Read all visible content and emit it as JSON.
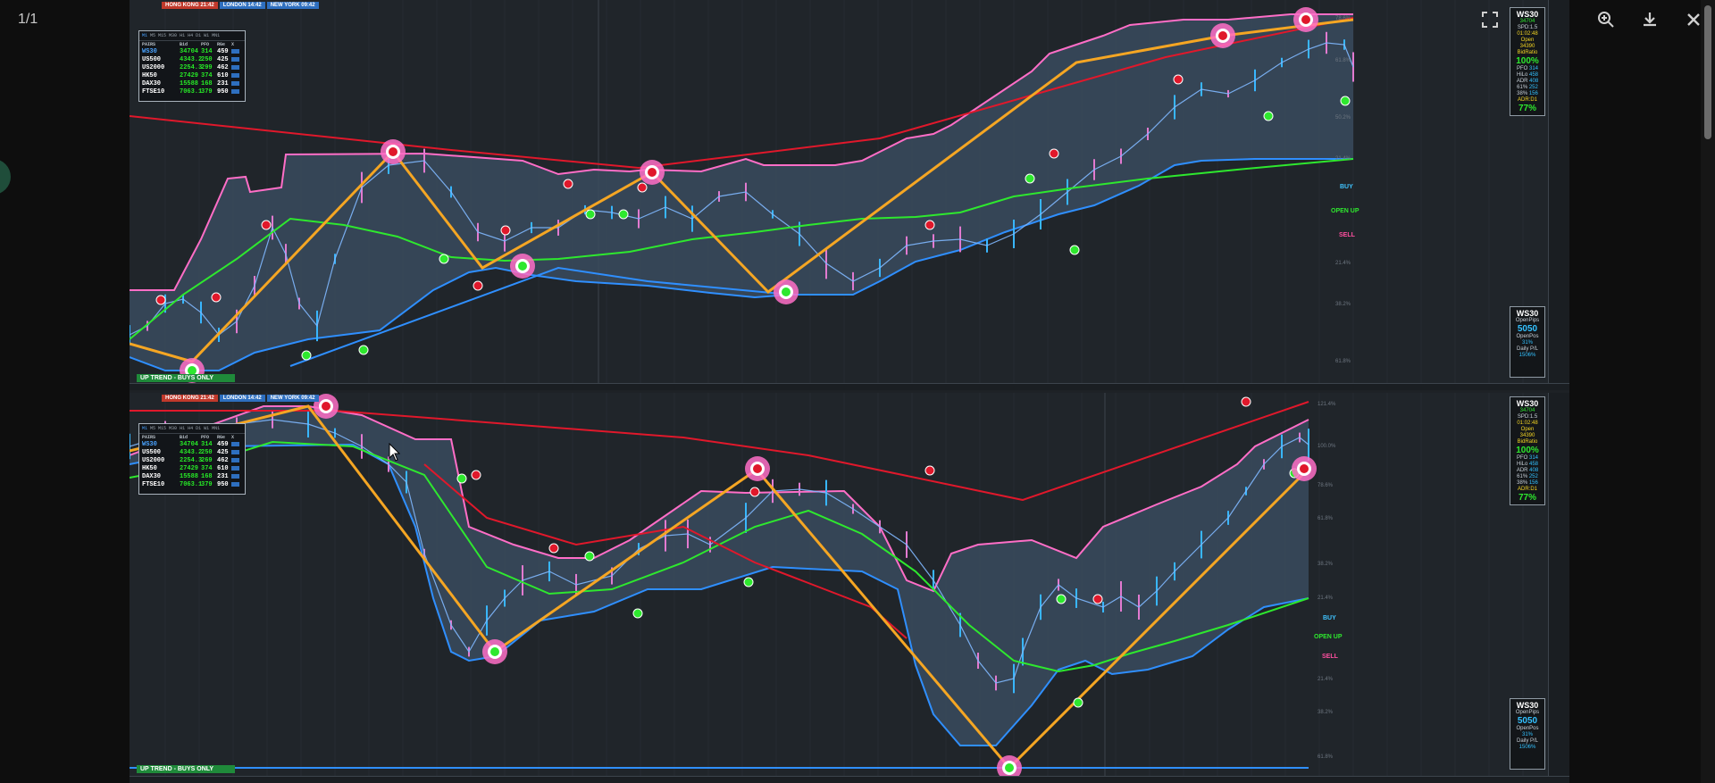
{
  "viewer": {
    "counter": "1/1",
    "toolbar": [
      {
        "name": "fullscreen-icon"
      },
      {
        "name": "zoom-in-icon"
      },
      {
        "name": "download-icon"
      },
      {
        "name": "close-icon"
      }
    ]
  },
  "colors": {
    "background": "#20252a",
    "cloud_fill": "#3a4b5e",
    "upper_band": "#ff6ec7",
    "lower_band": "#2f8fff",
    "zigzag": "#f5a623",
    "long_ma": "#2ee82e",
    "trendline": "#e0182b"
  },
  "top_chart": {
    "timezones": {
      "hk": "HONG KONG 21:42",
      "ld": "LONDON 14:42",
      "ny": "NEW YORK 09:42"
    },
    "pairs_tabs": [
      "M1",
      "M5",
      "M15",
      "M30",
      "H1",
      "H4",
      "D1",
      "W1",
      "MN1"
    ],
    "pairs_head": [
      "PAIRS",
      "Bid",
      "PFO",
      "RGe",
      "X"
    ],
    "pairs": [
      {
        "sym": "WS30",
        "bid": "34704",
        "pfo": "314",
        "rng": "459"
      },
      {
        "sym": "US500",
        "bid": "4343.2",
        "pfo": "250",
        "rng": "425"
      },
      {
        "sym": "US2000",
        "bid": "2254.3",
        "pfo": "299",
        "rng": "462"
      },
      {
        "sym": "HK50",
        "bid": "27429",
        "pfo": "374",
        "rng": "610"
      },
      {
        "sym": "DAX30",
        "bid": "15588",
        "pfo": "168",
        "rng": "231"
      },
      {
        "sym": "FTSE10",
        "bid": "7063.1",
        "pfo": "379",
        "rng": "950"
      }
    ],
    "trend": "UP TREND - BUYS ONLY",
    "signals": {
      "buy": "BUY",
      "open": "OPEN UP",
      "sell": "SELL"
    },
    "fibs": [
      "78.6%",
      "61.8%",
      "50.2%",
      "21.4%",
      "21.4%",
      "38.2%",
      "61.8%"
    ],
    "info_top": {
      "title": "WS30",
      "price": "34704",
      "spd": "SPD:1.5",
      "time": "01:02:48",
      "open_label": "Open",
      "open": "34390",
      "bid_label": "BidRatio",
      "bid": "100%",
      "pfo": "PFO",
      "hilo": "HiLo",
      "adr": "ADR",
      "p1": "61%",
      "p2": "38%",
      "adr_d": "ADR:D1",
      "adr_pct": "77%",
      "pfo_v": "314",
      "hilo_v": "458",
      "adr_v": "408",
      "p1_v": "252",
      "p2_v": "156"
    },
    "info_bottom": {
      "title": "WS30",
      "label1": "OpenPips",
      "val1": "5050",
      "label2": "OpenPos",
      "val2": "31%",
      "label3": "Daily P/L",
      "val3": "1506%"
    }
  },
  "bottom_chart": {
    "timezones": {
      "hk": "HONG KONG 21:42",
      "ld": "LONDON 14:42",
      "ny": "NEW YORK 09:42"
    },
    "pairs_tabs": [
      "M1",
      "M5",
      "M15",
      "M30",
      "H1",
      "H4",
      "D1",
      "W1",
      "MN1"
    ],
    "pairs_head": [
      "PAIRS",
      "Bid",
      "PFO",
      "RGe",
      "X"
    ],
    "pairs": [
      {
        "sym": "WS30",
        "bid": "34704",
        "pfo": "314",
        "rng": "459"
      },
      {
        "sym": "US500",
        "bid": "4343.2",
        "pfo": "250",
        "rng": "425"
      },
      {
        "sym": "US2000",
        "bid": "2254.3",
        "pfo": "269",
        "rng": "462"
      },
      {
        "sym": "HK50",
        "bid": "27429",
        "pfo": "374",
        "rng": "610"
      },
      {
        "sym": "DAX30",
        "bid": "15588",
        "pfo": "168",
        "rng": "231"
      },
      {
        "sym": "FTSE10",
        "bid": "7063.1",
        "pfo": "379",
        "rng": "950"
      }
    ],
    "trend": "UP TREND - BUYS ONLY",
    "signals": {
      "buy": "BUY",
      "open": "OPEN UP",
      "sell": "SELL"
    },
    "fibs": [
      "121.4%",
      "100.0%",
      "78.6%",
      "61.8%",
      "38.2%",
      "21.4%",
      "21.4%",
      "38.2%",
      "61.8%"
    ],
    "info_top": {
      "title": "WS30",
      "price": "34704",
      "spd": "SPD:1.5",
      "time": "01:02:48",
      "open_label": "Open",
      "open": "34390",
      "bid_label": "BidRatio",
      "bid": "100%",
      "pfo": "PFO",
      "hilo": "HiLo",
      "adr": "ADR",
      "p1": "61%",
      "p2": "38%",
      "adr_d": "ADR:D1",
      "adr_pct": "77%",
      "pfo_v": "314",
      "hilo_v": "458",
      "adr_v": "408",
      "p1_v": "252",
      "p2_v": "156"
    },
    "info_bottom": {
      "title": "WS30",
      "label1": "OpenPips",
      "val1": "5050",
      "label2": "OpenPos",
      "val2": "31%",
      "label3": "Daily P/L",
      "val3": "1506%"
    }
  }
}
